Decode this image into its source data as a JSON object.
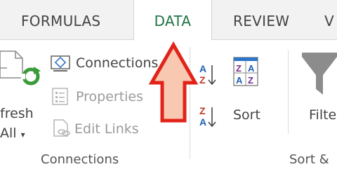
{
  "tabs": {
    "formulas": "FORMULAS",
    "data": "DATA",
    "review": "REVIEW",
    "partial": "V"
  },
  "connections_group": {
    "refresh_label_line1": "fresh",
    "refresh_label_line2": "All",
    "connections_label": "Connections",
    "properties_label": "Properties",
    "edit_links_label": "Edit Links",
    "group_label": "Connections"
  },
  "sort_group": {
    "sort_label": "Sort",
    "filter_label": "Filte",
    "group_label": "Sort &"
  },
  "colors": {
    "accent_green": "#217346",
    "arrow_fill": "#f8c8b0",
    "arrow_stroke": "#e2231a",
    "az_blue": "#1f5fb5",
    "za_red": "#c0392b"
  }
}
